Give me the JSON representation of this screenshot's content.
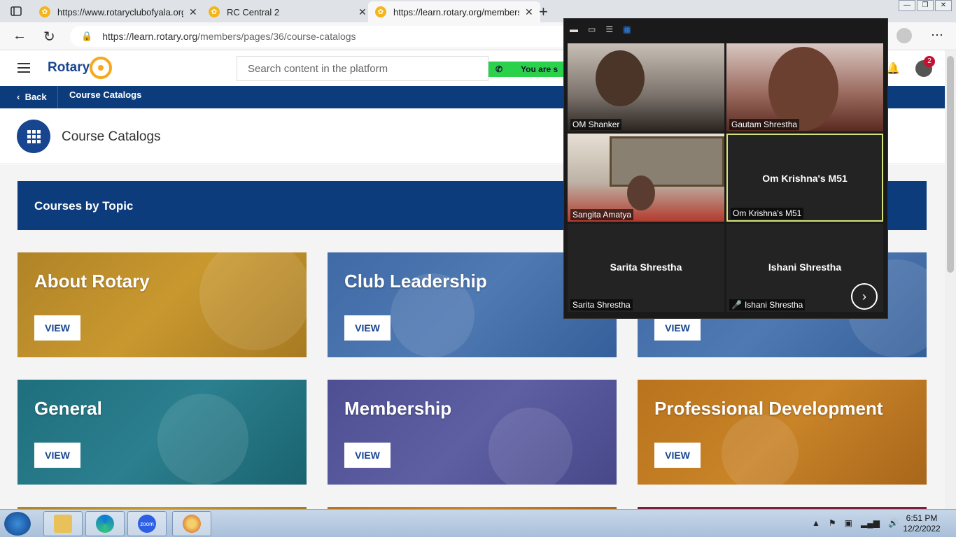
{
  "browser": {
    "tabs": [
      {
        "title": "https://www.rotaryclubofyala.org",
        "active": false
      },
      {
        "title": "RC Central 2",
        "active": false
      },
      {
        "title": "https://learn.rotary.org/members",
        "active": true
      }
    ],
    "url_host": "https://learn.rotary.org",
    "url_path": "/members/pages/36/course-catalogs"
  },
  "header": {
    "logo_text": "Rotary",
    "search_placeholder": "Search content in the platform",
    "secure_text": "You are s",
    "notification_count": "2"
  },
  "breadcrumb": {
    "back_label": "Back",
    "current": "Course Catalogs"
  },
  "page": {
    "title": "Course Catalogs",
    "section_title": "Courses by Topic"
  },
  "cards": [
    {
      "label": "About Rotary",
      "button": "VIEW"
    },
    {
      "label": "Club Leadership",
      "button": "VIEW"
    },
    {
      "label": "",
      "button": "VIEW"
    },
    {
      "label": "General",
      "button": "VIEW"
    },
    {
      "label": "Membership",
      "button": "VIEW"
    },
    {
      "label": "Professional Development",
      "button": "VIEW"
    }
  ],
  "zoom": {
    "participants": [
      {
        "name": "OM Shanker",
        "video": true
      },
      {
        "name": "Gautam Shrestha",
        "video": true
      },
      {
        "name": "Sangita Amatya",
        "video": true
      },
      {
        "name": "Om Krishna's M51",
        "center": "Om Krishna's M51",
        "video": false
      },
      {
        "name": "Sarita Shrestha",
        "center": "Sarita Shrestha",
        "video": false
      },
      {
        "name": "Ishani Shrestha",
        "center": "Ishani Shrestha",
        "video": false,
        "muted": true
      }
    ]
  },
  "taskbar": {
    "zoom_label": "zoom",
    "time": "6:51 PM",
    "date": "12/2/2022"
  },
  "colors": {
    "rotary_blue": "#17458f",
    "rotary_navy": "#0c3c7c",
    "rotary_gold": "#f7a81b"
  }
}
